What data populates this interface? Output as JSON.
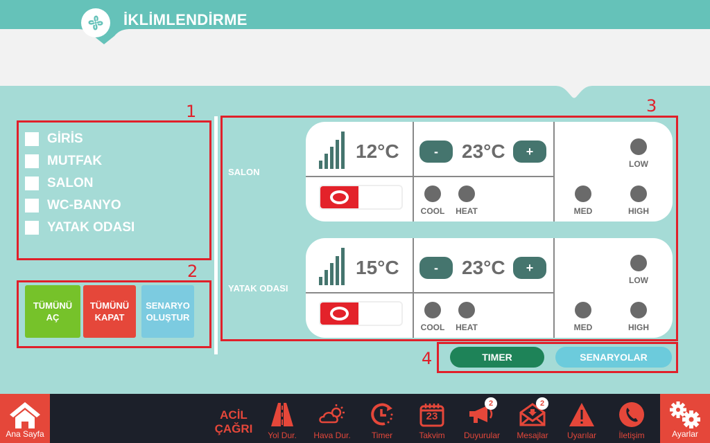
{
  "header": {
    "title": "İKLİMLENDİRME",
    "logo_icon": "fan-icon"
  },
  "annotations": [
    "1",
    "2",
    "3",
    "4"
  ],
  "rooms": [
    {
      "label": "GİRİS",
      "checked": false
    },
    {
      "label": "MUTFAK",
      "checked": false
    },
    {
      "label": "SALON",
      "checked": false
    },
    {
      "label": "WC-BANYO",
      "checked": false
    },
    {
      "label": "YATAK ODASI",
      "checked": false
    }
  ],
  "actions": {
    "open_all": "TÜMÜNÜ AÇ",
    "close_all": "TÜMÜNÜ KAPAT",
    "create_scenario": "SENARYO OLUŞTUR",
    "colors": {
      "open_all": "#76c22a",
      "close_all": "#e5473a",
      "create_scenario": "#7ccbe0"
    }
  },
  "ac_units": [
    {
      "room": "SALON",
      "current_temp": "12°C",
      "set_temp": "23°C",
      "minus": "-",
      "plus": "+",
      "power": "off",
      "modes": [
        "COOL",
        "HEAT"
      ],
      "fan_speeds": [
        "LOW",
        "MED",
        "HIGH"
      ]
    },
    {
      "room": "YATAK ODASI",
      "current_temp": "15°C",
      "set_temp": "23°C",
      "minus": "-",
      "plus": "+",
      "power": "off",
      "modes": [
        "COOL",
        "HEAT"
      ],
      "fan_speeds": [
        "LOW",
        "MED",
        "HIGH"
      ]
    }
  ],
  "tabs": {
    "timer": "TIMER",
    "scenarios": "SENARYOLAR",
    "colors": {
      "timer": "#1e8358",
      "scenarios": "#6ccbdc"
    }
  },
  "navbar": {
    "home": "Ana Sayfa",
    "emergency": "ACİL ÇAĞRI",
    "items": [
      {
        "label": "Yol Dur.",
        "icon": "road-icon"
      },
      {
        "label": "Hava Dur.",
        "icon": "weather-icon"
      },
      {
        "label": "Timer",
        "icon": "timer-icon"
      },
      {
        "label": "Takvim",
        "icon": "calendar-icon",
        "day": "23"
      },
      {
        "label": "Duyurular",
        "icon": "megaphone-icon",
        "badge": "2"
      },
      {
        "label": "Mesajlar",
        "icon": "mail-icon",
        "badge": "2"
      },
      {
        "label": "Uyarılar",
        "icon": "warning-icon"
      },
      {
        "label": "İletişim",
        "icon": "phone-icon"
      }
    ],
    "settings": "Ayarlar",
    "accent": "#e5473a"
  }
}
